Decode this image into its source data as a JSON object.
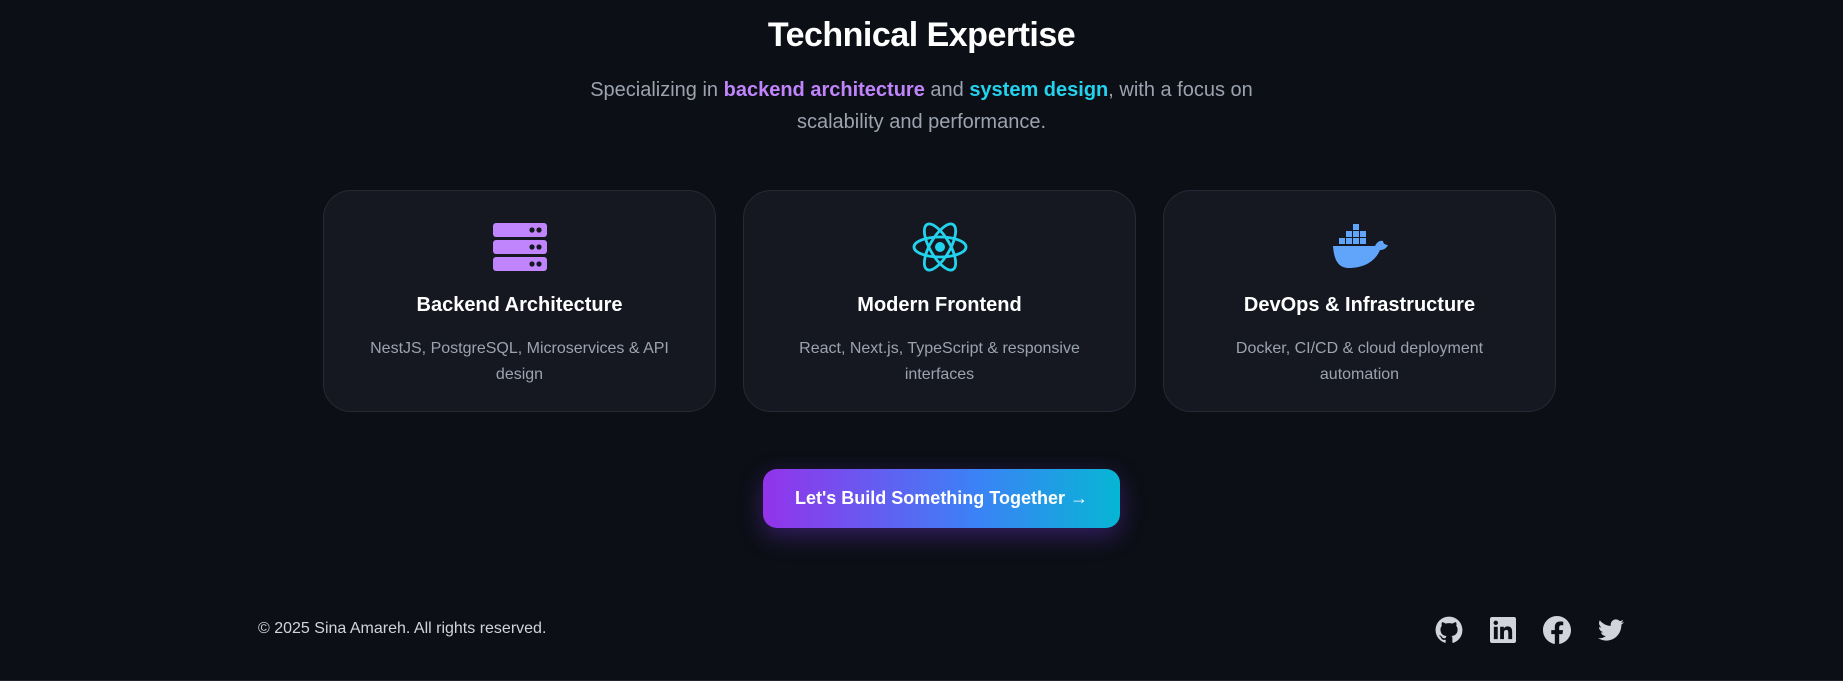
{
  "section": {
    "title": "Technical Expertise",
    "subtitle_prefix": "Specializing in ",
    "subtitle_highlight_1": "backend architecture",
    "subtitle_middle": " and ",
    "subtitle_highlight_2": "system design",
    "subtitle_suffix": ", with a focus on scalability and performance."
  },
  "cards": [
    {
      "title": "Backend Architecture",
      "description": "NestJS, PostgreSQL, Microservices & API design",
      "icon": "server-icon",
      "color": "#c084fc"
    },
    {
      "title": "Modern Frontend",
      "description": "React, Next.js, TypeScript & responsive interfaces",
      "icon": "react-icon",
      "color": "#22d3ee"
    },
    {
      "title": "DevOps & Infrastructure",
      "description": "Docker, CI/CD & cloud deployment automation",
      "icon": "docker-icon",
      "color": "#60a5fa"
    }
  ],
  "cta": {
    "label": "Let's Build Something Together →"
  },
  "footer": {
    "copyright": "© 2025 Sina Amareh. All rights reserved.",
    "socials": [
      "github-icon",
      "linkedin-icon",
      "facebook-icon",
      "twitter-icon"
    ]
  },
  "colors": {
    "background": "#0c0f16",
    "card": "#151821",
    "purple": "#c084fc",
    "cyan": "#22d3ee",
    "blue": "#60a5fa"
  }
}
